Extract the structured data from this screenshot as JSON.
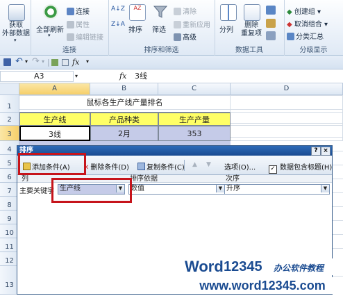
{
  "ribbon": {
    "get_external_data": "获取\n外部数据",
    "get_external_arrow": "▾",
    "refresh_all": "全部刷新",
    "refresh_arrow": "▾",
    "connections": "连接",
    "properties": "属性",
    "edit_links": "编辑链接",
    "group_connections": "连接",
    "sort_az": "A↓Z",
    "sort_za": "Z↓A",
    "sort": "排序",
    "filter": "筛选",
    "clear": "清除",
    "reapply": "重新应用",
    "advanced": "高级",
    "group_sort_filter": "排序和筛选",
    "text_to_columns": "分列",
    "remove_duplicates": "删除\n重复项",
    "group_data_tools": "数据工具",
    "group": "创建组",
    "ungroup": "取消组合",
    "subtotal": "分类汇总",
    "group_outline": "分级显示"
  },
  "qat": {
    "undo": "↶",
    "redo": "↷",
    "dropdown": "▾",
    "separator": "|",
    "fx_glyph": "fx"
  },
  "formula_bar": {
    "name_box": "A3",
    "fx": "fx",
    "value": "3线"
  },
  "grid": {
    "columns": [
      "A",
      "B",
      "C",
      "D"
    ],
    "rows": [
      "1",
      "2",
      "3",
      "4",
      "5",
      "6",
      "7",
      "8",
      "9",
      "10",
      "11",
      "12",
      "13"
    ],
    "title": "鼠标各生产线产量排名",
    "headers": [
      "生产线",
      "产品种类",
      "生产产量"
    ],
    "row3": [
      "3线",
      "2月",
      "353"
    ]
  },
  "dialog": {
    "title": "排序",
    "help": "?",
    "close": "×",
    "add_level": "添加条件(A)",
    "delete_level": "删除条件(D)",
    "copy_level": "复制条件(C)",
    "move_up": "▲",
    "move_down": "▼",
    "options": "选项(O)...",
    "has_headers_checkbox": "✓",
    "has_headers": "数据包含标题(H)",
    "col_header": "列",
    "sort_on_header": "排序依据",
    "order_header": "次序",
    "row_label": "主要关键字",
    "column_value": "生产线",
    "sort_on_value": "数值",
    "order_value": "升序",
    "combo_arrow": "▼"
  },
  "watermark": {
    "logo_word": "Word",
    "logo_digits": "12345",
    "logo_tagline": "办公软件教程",
    "url": "www.word12345.com"
  },
  "colors": {
    "accent": "#1a4b91",
    "highlight": "#c6141b",
    "header_fill": "#ffff66",
    "selected_row": "#c5cbe8"
  }
}
